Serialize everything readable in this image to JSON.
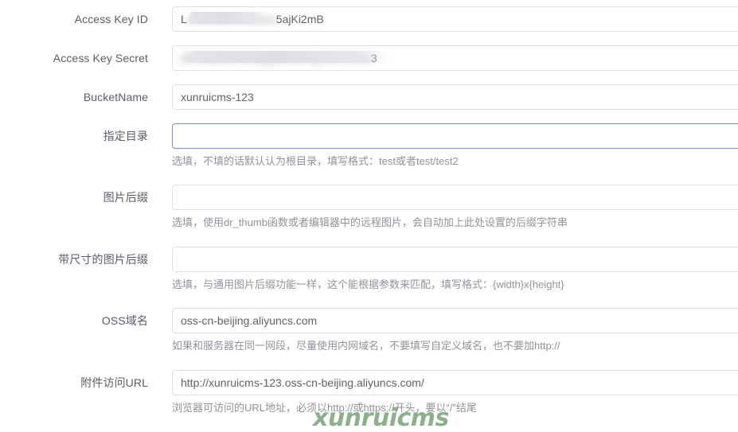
{
  "form": {
    "rows": [
      {
        "label": "Access Key ID",
        "value_prefix": "L",
        "value_masked": "xxxxxxxxxxxxxxxx",
        "value_suffix": "5ajKi2mB",
        "redacted": true,
        "focused": false,
        "help": ""
      },
      {
        "label": "Access Key Secret",
        "value_prefix": "",
        "value_masked": "tJYZNjH9K71N8gQMRMYgZWFZ6ND",
        "value_suffix": "3",
        "redacted": true,
        "focused": false,
        "help": ""
      },
      {
        "label": "BucketName",
        "value": "xunruicms-123",
        "redacted": false,
        "focused": false,
        "help": ""
      },
      {
        "label": "指定目录",
        "value": "",
        "placeholder": "",
        "redacted": false,
        "focused": true,
        "help": "选填，不填的话默认认为根目录，填写格式：test或者test/test2"
      },
      {
        "label": "图片后缀",
        "value": "",
        "placeholder": "",
        "redacted": false,
        "focused": false,
        "help": "选填，使用dr_thumb函数或者编辑器中的远程图片，会自动加上此处设置的后缀字符串"
      },
      {
        "label": "带尺寸的图片后缀",
        "value": "",
        "placeholder": "",
        "redacted": false,
        "focused": false,
        "help": "选填，与通用图片后缀功能一样，这个能根据参数来匹配，填写格式：{width}x{height}"
      },
      {
        "label": "OSS域名",
        "value": "oss-cn-beijing.aliyuncs.com",
        "redacted": false,
        "focused": false,
        "help": "如果和服务器在同一网段，尽量使用内网域名，不要填写自定义域名，也不要加http://"
      },
      {
        "label": "附件访问URL",
        "value": "http://xunruicms-123.oss-cn-beijing.aliyuncs.com/",
        "redacted": false,
        "focused": false,
        "help": "浏览器可访问的URL地址，必须以http://或https://开头，要以“/”结尾"
      }
    ]
  },
  "watermark": {
    "text": "xunruicms",
    "color": "#83a983"
  },
  "theme": {
    "label_color": "#5a5e66",
    "value_color": "#606266",
    "help_color": "#909399",
    "border_color": "#dcdfe6",
    "focus_border_color": "#7b93ba",
    "background": "#ffffff"
  }
}
